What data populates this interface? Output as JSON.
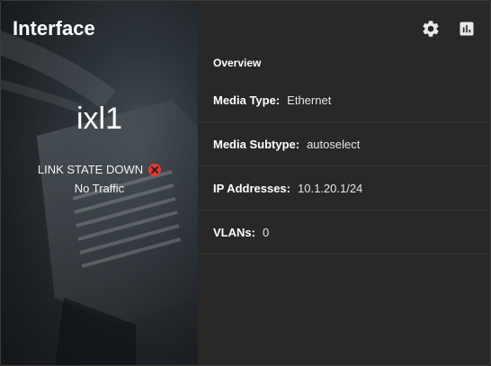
{
  "card": {
    "title": "Interface",
    "interface_name": "ixl1",
    "link_state": "LINK STATE DOWN",
    "traffic": "No Traffic"
  },
  "toolbar": {
    "settings_icon": "gear-icon",
    "reports_icon": "bar-chart-icon"
  },
  "overview": {
    "title": "Overview",
    "rows": [
      {
        "label": "Media Type:",
        "value": "Ethernet"
      },
      {
        "label": "Media Subtype:",
        "value": "autoselect"
      },
      {
        "label": "IP Addresses:",
        "value": "10.1.20.1/24"
      },
      {
        "label": "VLANs:",
        "value": "0"
      }
    ]
  },
  "colors": {
    "status_error": "#e53935",
    "panel_bg": "#282828"
  }
}
